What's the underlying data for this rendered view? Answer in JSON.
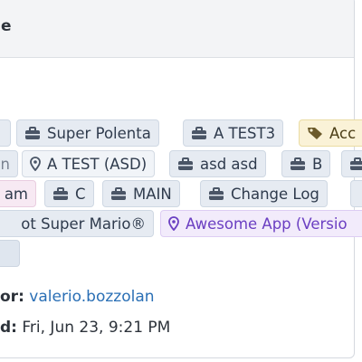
{
  "panel": {
    "title_visible": "e"
  },
  "tags": [
    {
      "label": "Super Polenta",
      "icon": "briefcase-icon"
    },
    {
      "label": "A TEST3",
      "icon": "briefcase-icon"
    },
    {
      "label": "Acc",
      "icon": "tag-icon"
    },
    {
      "label": "n",
      "icon": ""
    },
    {
      "label": "A TEST (ASD)",
      "icon": "map-pin-icon"
    },
    {
      "label": "asd asd",
      "icon": "briefcase-icon"
    },
    {
      "label": "B",
      "icon": "briefcase-icon"
    },
    {
      "label": "am",
      "icon": ""
    },
    {
      "label": "C",
      "icon": "briefcase-icon"
    },
    {
      "label": "MAIN",
      "icon": "briefcase-icon"
    },
    {
      "label": "Change Log",
      "icon": "briefcase-icon"
    },
    {
      "label": "ot Super Mario®",
      "icon": ""
    },
    {
      "label": "Awesome App (Versio",
      "icon": "map-pin-icon"
    }
  ],
  "meta": {
    "creator_label": "or:",
    "creator_value": "valerio.bozzolan",
    "created_label": "d:",
    "created_value": "Fri, Jun 23, 9:21 PM"
  },
  "colors": {
    "tag_bg": "#e6ebf2",
    "tag_yellow_bg": "#faf2d7",
    "tag_purple_bg": "#f2ebfb",
    "tag_pink_bg": "#f7e9f3",
    "link": "#2a6fb5"
  }
}
